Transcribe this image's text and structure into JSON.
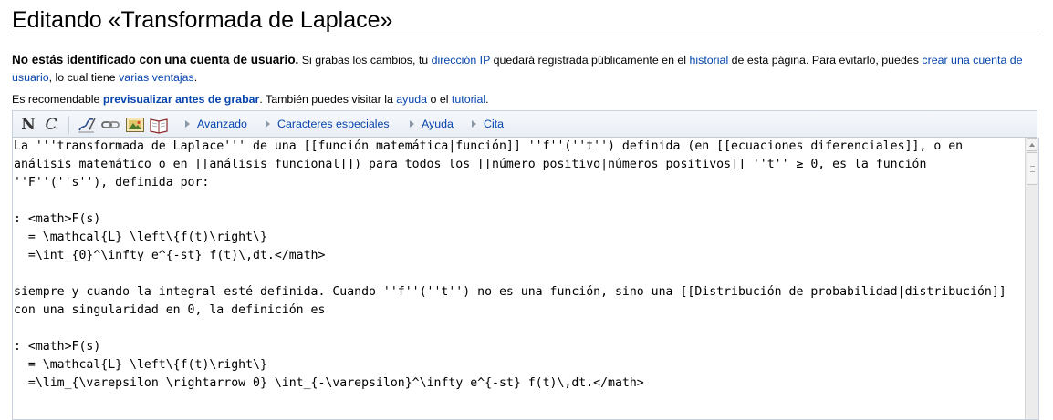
{
  "page": {
    "title": "Editando «Transformada de Laplace»"
  },
  "notice": {
    "bold": "No estás identificado con una cuenta de usuario.",
    "t1": " Si grabas los cambios, tu ",
    "link_ip": "dirección IP",
    "t2": " quedará registrada públicamente en el ",
    "link_history": "historial",
    "t3": " de esta página. Para evitarlo, puedes ",
    "link_create": "crear una cuenta de usuario",
    "t4": ", lo cual tiene ",
    "link_advantages": "varias ventajas",
    "t5": "."
  },
  "hint": {
    "t1": "Es recomendable ",
    "link_preview": "previsualizar antes de grabar",
    "t2": ". También puedes visitar la ",
    "link_help": "ayuda",
    "t3": " o el ",
    "link_tutorial": "tutorial",
    "t4": "."
  },
  "toolbar": {
    "bold_label": "N",
    "italic_label": "C",
    "icons": [
      "signature-icon",
      "link-icon",
      "image-icon",
      "reference-icon"
    ],
    "groups": [
      "Avanzado",
      "Caracteres especiales",
      "Ayuda",
      "Cita"
    ]
  },
  "editor": {
    "content": "La '''transformada de Laplace''' de una [[función matemática|función]] ''f''(''t'') definida (en [[ecuaciones diferenciales]], o en análisis matemático o en [[análisis funcional]]) para todos los [[número positivo|números positivos]] ''t'' ≥ 0, es la función ''F''(''s''), definida por:\n\n: <math>F(s)\n  = \\mathcal{L} \\left\\{f(t)\\right\\}\n  =\\int_{0}^\\infty e^{-st} f(t)\\,dt.</math>\n\nsiempre y cuando la integral esté definida. Cuando ''f''(''t'') no es una función, sino una [[Distribución de probabilidad|distribución]] con una singularidad en 0, la definición es\n\n: <math>F(s)\n  = \\mathcal{L} \\left\\{f(t)\\right\\}\n  =\\lim_{\\varepsilon \\rightarrow 0} \\int_{-\\varepsilon}^\\infty e^{-st} f(t)\\,dt.</math>\n"
  },
  "colors": {
    "link": "#0645ad",
    "toolbar_bg": "#eef2f7",
    "border": "#c7d2de"
  }
}
